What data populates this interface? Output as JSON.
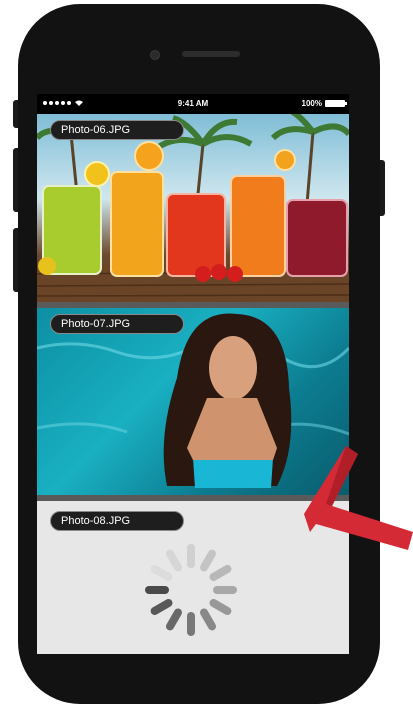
{
  "status_bar": {
    "time": "9:41 AM",
    "battery": "100%",
    "signal_dots": 5
  },
  "photos": [
    {
      "label": "Photo-06.JPG",
      "state": "loaded",
      "subject": "colorful juices on wooden table"
    },
    {
      "label": "Photo-07.JPG",
      "state": "loaded",
      "subject": "woman in turquoise pool"
    },
    {
      "label": "Photo-08.JPG",
      "state": "loading",
      "subject": "loading spinner"
    }
  ],
  "colors": {
    "phone_body": "#121212",
    "status_bar": "#000000",
    "label_bg": "#1e1e1e",
    "arrow": "#d42a35",
    "spinner": "#4a4a4a"
  }
}
